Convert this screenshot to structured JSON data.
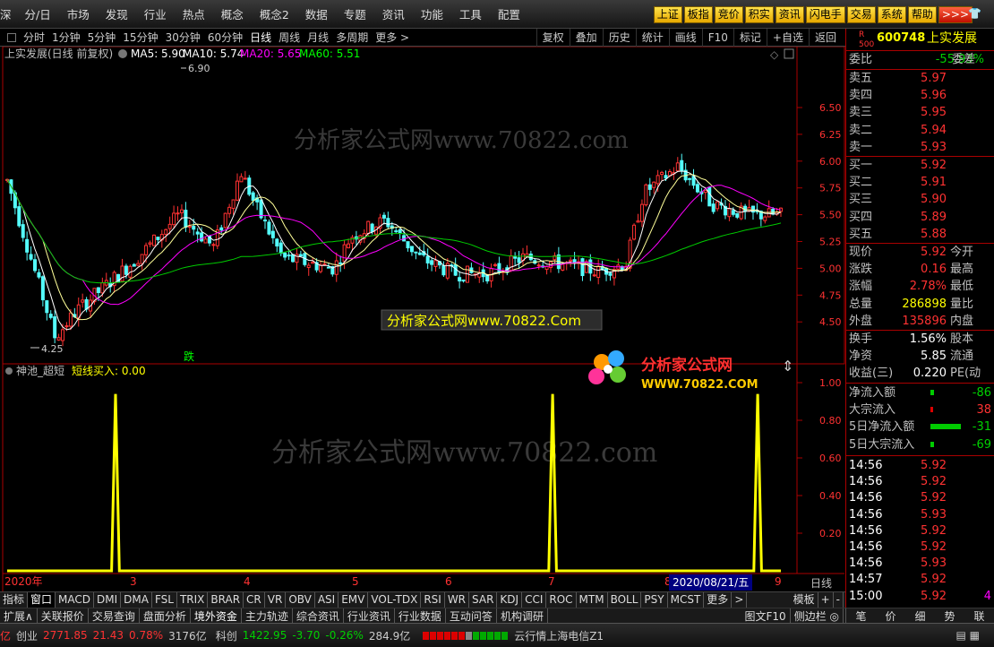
{
  "top_menu": {
    "items": [
      "深",
      "分/日",
      "市场",
      "发现",
      "行业",
      "热点",
      "概念",
      "概念2",
      "数据",
      "专题",
      "资讯",
      "功能",
      "工具",
      "配置"
    ],
    "buttons": [
      "上证",
      "板指",
      "竞价",
      "积实",
      "资讯",
      "闪电手",
      "交易",
      "系统",
      "帮助"
    ],
    "more": ">>>"
  },
  "period_bar": {
    "items": [
      "分时",
      "1分钟",
      "5分钟",
      "15分钟",
      "30分钟",
      "60分钟",
      "日线",
      "周线",
      "月线",
      "多周期",
      "更多 >"
    ],
    "active": "日线",
    "right_buttons": [
      "复权",
      "叠加",
      "历史",
      "统计",
      "画线",
      "F10",
      "标记",
      "+自选",
      "返回"
    ]
  },
  "main_chart": {
    "title": "上实发展(日线 前复权)",
    "legend": [
      {
        "label": "MA5: 5.90",
        "color": "#ffffff"
      },
      {
        "label": "MA10: 5.74",
        "color": "#ffffff"
      },
      {
        "label": "MA20: 5.65",
        "color": "#ff00ff"
      },
      {
        "label": "MA60: 5.51",
        "color": "#00ff00"
      }
    ],
    "price_ticks": [
      "6.50",
      "6.25",
      "6.00",
      "5.75",
      "5.50",
      "5.25",
      "5.00",
      "4.75",
      "4.50"
    ],
    "high_label": "6.90",
    "low_label": "4.25",
    "marker_text": "跌",
    "watermark_top": "分析家公式网www.70822.com",
    "watermark_box": "分析家公式网www.70822.Com"
  },
  "sub_chart": {
    "title": "神池_超短",
    "legend": "短线买入: 0.00",
    "ticks": [
      "1.00",
      "0.80",
      "0.60",
      "0.40",
      "0.20"
    ],
    "watermark": "分析家公式网www.70822.com",
    "logo_text": "分析家公式网",
    "logo_url": "WWW.70822.COM"
  },
  "x_axis": {
    "labels": [
      "2020年",
      "3",
      "4",
      "5",
      "6",
      "7",
      "8",
      "9"
    ],
    "date_box": "2020/08/21/五",
    "period": "日线"
  },
  "chart_data": {
    "type": "candlestick",
    "y_range": [
      4.25,
      6.9
    ],
    "signal_values": [
      0,
      0,
      0,
      0,
      0,
      0,
      0,
      0,
      0,
      0,
      0,
      0,
      0,
      0,
      0,
      0,
      0,
      0,
      0,
      0,
      0,
      0,
      0,
      0,
      0,
      0,
      0,
      0,
      1,
      0,
      0,
      0,
      0,
      0,
      0,
      0,
      0,
      0,
      0,
      0,
      0,
      0,
      0,
      0,
      0,
      0,
      0,
      0,
      0,
      0,
      0,
      0,
      0,
      0,
      0,
      0,
      0,
      0,
      0,
      0,
      0,
      0,
      0,
      0,
      0,
      0,
      0,
      0,
      0,
      0,
      0,
      0,
      0,
      0,
      0,
      0,
      0,
      0,
      0,
      0,
      0,
      0,
      0,
      0,
      0,
      0,
      0,
      0,
      0,
      0,
      0,
      0,
      0,
      0,
      0,
      0,
      0,
      0,
      0,
      0,
      0,
      0,
      0,
      0,
      0,
      0,
      0,
      0,
      0,
      0,
      0,
      0,
      0,
      0,
      0,
      0,
      0,
      0,
      0,
      0,
      0,
      0,
      0,
      0,
      0,
      0,
      0,
      0,
      0,
      0,
      0,
      0,
      0,
      0,
      0,
      0,
      0,
      0,
      0,
      0,
      0,
      1,
      0,
      0,
      0,
      0,
      0,
      0,
      0,
      0,
      0,
      0,
      0,
      0,
      0,
      0,
      0,
      0,
      0,
      0,
      0,
      0,
      0,
      0,
      0,
      0,
      0,
      0,
      0,
      0,
      0,
      0,
      0,
      0,
      0,
      0,
      0,
      0,
      0,
      0,
      0,
      0,
      0,
      0,
      0,
      0,
      0,
      0,
      0,
      0,
      0,
      0,
      0,
      0,
      1,
      0,
      0,
      0,
      0,
      0,
      0
    ]
  },
  "quote": {
    "code": "600748",
    "name": "上实发展",
    "badge_r": "R",
    "badge_num": "500",
    "weibi": {
      "label": "委比",
      "value": "-55.93%",
      "right": "委差"
    },
    "asks": [
      {
        "label": "卖五",
        "price": "5.97"
      },
      {
        "label": "卖四",
        "price": "5.96"
      },
      {
        "label": "卖三",
        "price": "5.95"
      },
      {
        "label": "卖二",
        "price": "5.94"
      },
      {
        "label": "卖一",
        "price": "5.93"
      }
    ],
    "bids": [
      {
        "label": "买一",
        "price": "5.92"
      },
      {
        "label": "买二",
        "price": "5.91"
      },
      {
        "label": "买三",
        "price": "5.90"
      },
      {
        "label": "买四",
        "price": "5.89"
      },
      {
        "label": "买五",
        "price": "5.88"
      }
    ],
    "stats": [
      {
        "label": "现价",
        "value": "5.92",
        "right": "今开"
      },
      {
        "label": "涨跌",
        "value": "0.16",
        "right": "最高"
      },
      {
        "label": "涨幅",
        "value": "2.78%",
        "right": "最低"
      },
      {
        "label": "总量",
        "value": "286898",
        "right": "量比"
      },
      {
        "label": "外盘",
        "value": "135896",
        "right": "内盘"
      }
    ],
    "stats2": [
      {
        "label": "换手",
        "value": "1.56%",
        "right": "股本"
      },
      {
        "label": "净资",
        "value": "5.85",
        "right": "流通"
      },
      {
        "label": "收益(三)",
        "value": "0.220",
        "right": "PE(动"
      }
    ],
    "flows": [
      {
        "label": "净流入额",
        "value": "-86"
      },
      {
        "label": "大宗流入",
        "value": "38"
      },
      {
        "label": "5日净流入额",
        "value": "-31"
      },
      {
        "label": "5日大宗流入",
        "value": "-69"
      }
    ],
    "ticks": [
      {
        "time": "14:56",
        "price": "5.92"
      },
      {
        "time": "14:56",
        "price": "5.92"
      },
      {
        "time": "14:56",
        "price": "5.92"
      },
      {
        "time": "14:56",
        "price": "5.93"
      },
      {
        "time": "14:56",
        "price": "5.92"
      },
      {
        "time": "14:56",
        "price": "5.92"
      },
      {
        "time": "14:56",
        "price": "5.93"
      },
      {
        "time": "14:57",
        "price": "5.92"
      },
      {
        "time": "15:00",
        "price": "5.92"
      }
    ],
    "last_vol": "4"
  },
  "indicator_bar": [
    "指标",
    "窗口",
    "MACD",
    "DMI",
    "DMA",
    "FSL",
    "TRIX",
    "BRAR",
    "CR",
    "VR",
    "OBV",
    "ASI",
    "EMV",
    "VOL-TDX",
    "RSI",
    "WR",
    "SAR",
    "KDJ",
    "CCI",
    "ROC",
    "MTM",
    "BOLL",
    "PSY",
    "MCST",
    "更多"
  ],
  "indicator_right": [
    "模板",
    "+",
    "-"
  ],
  "ext_bar": [
    "扩展∧",
    "关联报价",
    "交易查询",
    "盘面分析",
    "境外资金",
    "主力轨迹",
    "综合资讯",
    "行业资讯",
    "行业数据",
    "互动问答",
    "机构调研"
  ],
  "ext_right": [
    "图文F10",
    "侧边栏 ◎"
  ],
  "right_tabs": [
    "笔",
    "价",
    "细",
    "势",
    "联"
  ],
  "status": {
    "a": "亿",
    "cyb_label": "创业",
    "cyb_value": "2771.85",
    "cyb_change": "21.43",
    "cyb_pct": "0.78%",
    "cyb_amount": "3176亿",
    "kc_label": "科创",
    "kc_value": "1422.95",
    "kc_change": "-3.70",
    "kc_pct": "-0.26%",
    "kc_amount": "284.9亿",
    "server": "云行情上海电信Z1"
  }
}
